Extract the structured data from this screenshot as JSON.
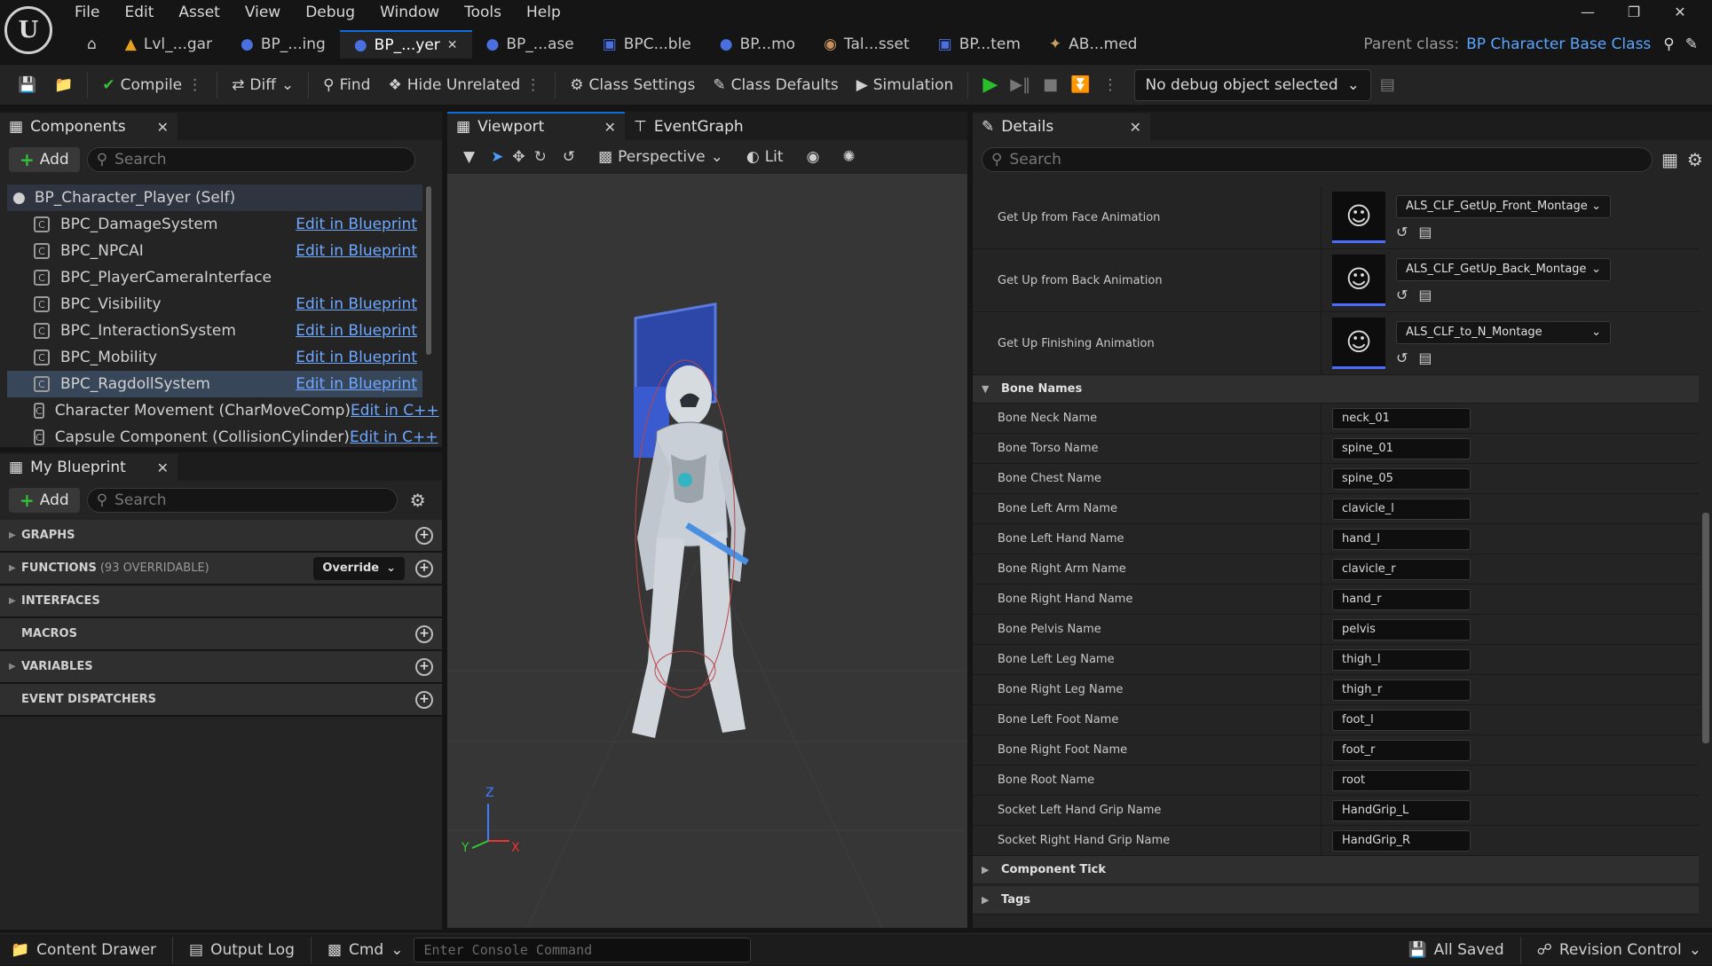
{
  "menu": [
    "File",
    "Edit",
    "Asset",
    "View",
    "Debug",
    "Window",
    "Tools",
    "Help"
  ],
  "tabs": [
    {
      "label": "Lvl_...gar",
      "icon": "level-icon"
    },
    {
      "label": "BP_...ing",
      "icon": "blueprint-icon"
    },
    {
      "label": "BP_...yer",
      "icon": "character-icon",
      "active": true
    },
    {
      "label": "BP_...ase",
      "icon": "blueprint-icon"
    },
    {
      "label": "BPC...ble",
      "icon": "component-icon"
    },
    {
      "label": "BP...mo",
      "icon": "blueprint-icon"
    },
    {
      "label": "Tal...sset",
      "icon": "asset-icon"
    },
    {
      "label": "BP...tem",
      "icon": "component-icon"
    },
    {
      "label": "AB...med",
      "icon": "anim-blueprint-icon"
    }
  ],
  "parent_class": {
    "label": "Parent class:",
    "value": "BP Character Base Class"
  },
  "toolbar": {
    "compile": "Compile",
    "diff": "Diff",
    "find": "Find",
    "hide_unrelated": "Hide Unrelated",
    "class_settings": "Class Settings",
    "class_defaults": "Class Defaults",
    "simulation": "Simulation",
    "debug_object": "No debug object selected"
  },
  "components": {
    "title": "Components",
    "add": "Add",
    "search_placeholder": "Search",
    "root": "BP_Character_Player (Self)",
    "items": [
      {
        "name": "BPC_DamageSystem",
        "link": "Edit in Blueprint"
      },
      {
        "name": "BPC_NPCAI",
        "link": "Edit in Blueprint"
      },
      {
        "name": "BPC_PlayerCameraInterface",
        "link": ""
      },
      {
        "name": "BPC_Visibility",
        "link": "Edit in Blueprint"
      },
      {
        "name": "BPC_InteractionSystem",
        "link": "Edit in Blueprint"
      },
      {
        "name": "BPC_Mobility",
        "link": "Edit in Blueprint"
      },
      {
        "name": "BPC_RagdollSystem",
        "link": "Edit in Blueprint",
        "selected": true
      },
      {
        "name": "Character Movement (CharMoveComp)",
        "link": "Edit in C++"
      },
      {
        "name": "Capsule Component (CollisionCylinder)",
        "link": "Edit in C++"
      }
    ]
  },
  "my_blueprint": {
    "title": "My Blueprint",
    "add": "Add",
    "search_placeholder": "Search",
    "sections": [
      {
        "label": "GRAPHS",
        "count": "",
        "addable": true,
        "expandable": true
      },
      {
        "label": "FUNCTIONS",
        "count": "(93 OVERRIDABLE)",
        "addable": true,
        "expandable": true,
        "override": "Override"
      },
      {
        "label": "INTERFACES",
        "count": "",
        "addable": false,
        "expandable": true
      },
      {
        "label": "MACROS",
        "count": "",
        "addable": true,
        "expandable": false
      },
      {
        "label": "VARIABLES",
        "count": "",
        "addable": true,
        "expandable": true
      },
      {
        "label": "EVENT DISPATCHERS",
        "count": "",
        "addable": true,
        "expandable": false
      }
    ]
  },
  "viewport": {
    "tab_viewport": "Viewport",
    "tab_eventgraph": "EventGraph",
    "perspective": "Perspective",
    "lit": "Lit",
    "axis_z": "Z",
    "axis_y": "Y",
    "axis_x": "X"
  },
  "details": {
    "title": "Details",
    "search_placeholder": "Search",
    "animations": [
      {
        "label": "Get Up from Face Animation",
        "value": "ALS_CLF_GetUp_Front_Montage"
      },
      {
        "label": "Get Up from Back Animation",
        "value": "ALS_CLF_GetUp_Back_Montage"
      },
      {
        "label": "Get Up Finishing Animation",
        "value": "ALS_CLF_to_N_Montage"
      }
    ],
    "bone_category": "Bone Names",
    "bones": [
      {
        "label": "Bone Neck Name",
        "value": "neck_01"
      },
      {
        "label": "Bone Torso Name",
        "value": "spine_01"
      },
      {
        "label": "Bone Chest Name",
        "value": "spine_05"
      },
      {
        "label": "Bone Left Arm Name",
        "value": "clavicle_l"
      },
      {
        "label": "Bone Left Hand Name",
        "value": "hand_l"
      },
      {
        "label": "Bone Right Arm Name",
        "value": "clavicle_r"
      },
      {
        "label": "Bone Right Hand Name",
        "value": "hand_r"
      },
      {
        "label": "Bone Pelvis Name",
        "value": "pelvis"
      },
      {
        "label": "Bone Left Leg Name",
        "value": "thigh_l"
      },
      {
        "label": "Bone Right Leg Name",
        "value": "thigh_r"
      },
      {
        "label": "Bone Left Foot Name",
        "value": "foot_l"
      },
      {
        "label": "Bone Right Foot Name",
        "value": "foot_r"
      },
      {
        "label": "Bone Root Name",
        "value": "root"
      },
      {
        "label": "Socket Left Hand Grip Name",
        "value": "HandGrip_L"
      },
      {
        "label": "Socket Right Hand Grip Name",
        "value": "HandGrip_R"
      }
    ],
    "categories_after": [
      "Component Tick",
      "Tags"
    ]
  },
  "statusbar": {
    "content_drawer": "Content Drawer",
    "output_log": "Output Log",
    "cmd": "Cmd",
    "console_placeholder": "Enter Console Command",
    "all_saved": "All Saved",
    "revision_control": "Revision Control"
  },
  "colors": {
    "accent": "#0f6cd8",
    "link": "#6fa8ff",
    "play": "#28c028",
    "selection": "#38465a"
  }
}
